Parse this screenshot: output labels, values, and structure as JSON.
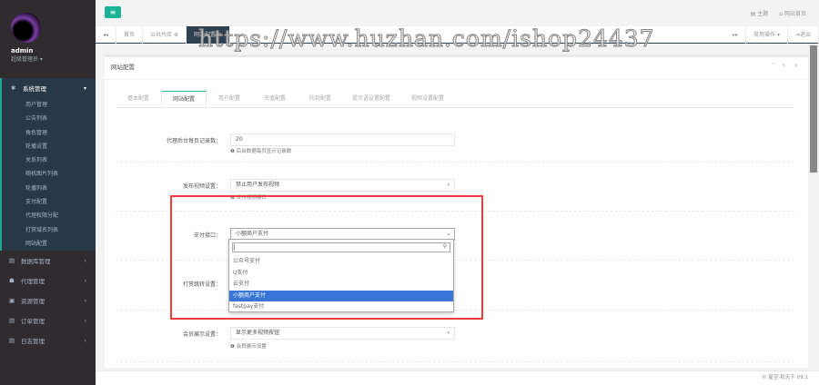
{
  "sidebar": {
    "username": "admin",
    "role": "超级管理员 ▾",
    "active_group": "系统管理",
    "sub_items": [
      "用户管理",
      "公告列表",
      "角色管理",
      "轮播设置",
      "关系列表",
      "随机图片列表",
      "轮播列表",
      "支付配置",
      "代理权限分配",
      "打赏域名列表",
      "网站配置"
    ],
    "groups": [
      {
        "label": "数据库管理"
      },
      {
        "label": "代理管理"
      },
      {
        "label": "资源管理"
      },
      {
        "label": "订单管理"
      },
      {
        "label": "日志管理"
      }
    ]
  },
  "topbar": {
    "menu_icon": "≡",
    "notice": "主题",
    "home": "网站首页"
  },
  "tabs": {
    "items": [
      "首页",
      "公共片库 ⊗",
      "网站配置 ⊗"
    ],
    "ops": "常用操作 ▾",
    "logout": "退出"
  },
  "watermark": "https://www.huzhan.com/ishop24437",
  "panel": {
    "title": "网站配置",
    "form_tabs": [
      "基本配置",
      "网站配置",
      "用户配置",
      "充值配置",
      "防封配置",
      "提示语设置配置",
      "视频设置配置"
    ],
    "fields": [
      {
        "label": "代理后台每页记录数：",
        "value": "20",
        "help": "后台数据每页显示记录数"
      },
      {
        "label": "发布视频设置：",
        "value": "禁止用户发布视频",
        "help": "发布视频接口"
      },
      {
        "label": "支付接口：",
        "value": "小额商户支付"
      },
      {
        "label": "打赏跳转设置："
      },
      {
        "label": "会员展示设置：",
        "value": "显示更多视频按钮",
        "help": "会员展示设置"
      }
    ],
    "dropdown": {
      "search": "",
      "options": [
        "公众号支付",
        "U支付",
        "云支付",
        "小额商户支付",
        "fastpay支付"
      ],
      "selected": 3
    }
  },
  "footer": "© 星空-和天下 V9.1"
}
